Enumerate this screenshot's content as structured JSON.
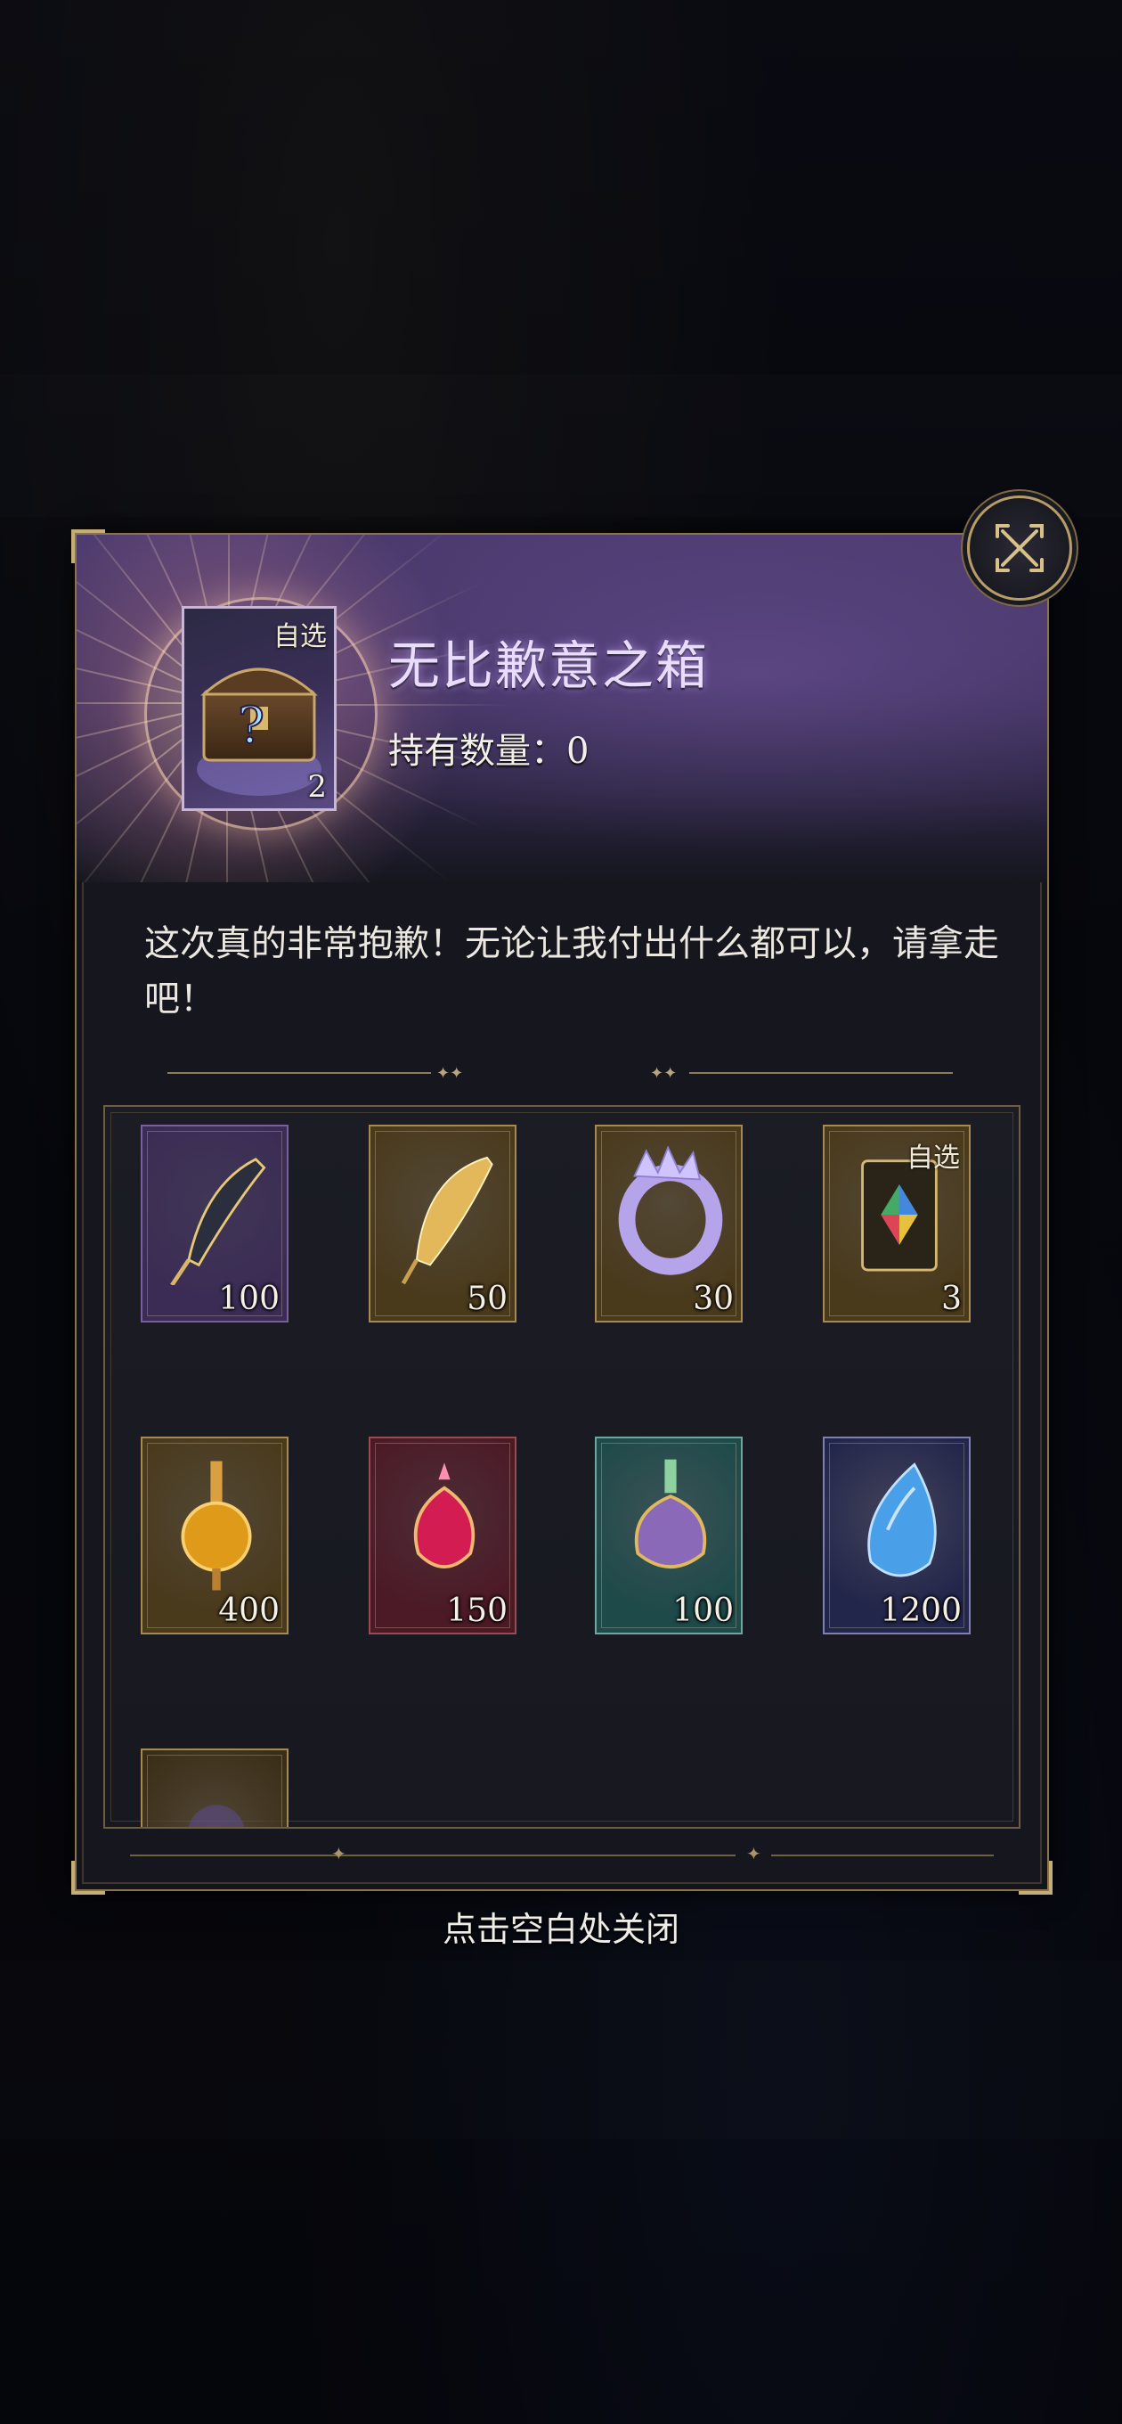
{
  "dialog": {
    "title": "无比歉意之箱",
    "owned_label": "持有数量：0",
    "main_item": {
      "tag": "自选",
      "count": "2",
      "icon": "mystery-chest-icon"
    },
    "description": "这次真的非常抱歉！无论让我付出什么都可以，请拿走吧！",
    "close_icon": "close-x-icon"
  },
  "rewards": [
    {
      "name": "dark-quill-icon",
      "count": "100",
      "frame": "#7a5fa0",
      "bg": "#3b2c55"
    },
    {
      "name": "golden-feather-icon",
      "count": "50",
      "frame": "#a68a52",
      "bg": "#4a3a1c"
    },
    {
      "name": "crystal-ring-icon",
      "count": "30",
      "frame": "#a68a52",
      "bg": "#4a3a1c"
    },
    {
      "name": "selectable-card-icon",
      "count": "3",
      "tag": "自选",
      "frame": "#a68a52",
      "bg": "#4a3a1c"
    },
    {
      "name": "amber-potion-icon",
      "count": "400",
      "frame": "#a68a52",
      "bg": "#4a3a1c"
    },
    {
      "name": "crimson-potion-icon",
      "count": "150",
      "frame": "#9a4a55",
      "bg": "#4c1a26"
    },
    {
      "name": "teal-potion-icon",
      "count": "100",
      "frame": "#6fa6a0",
      "bg": "#1f4a4a"
    },
    {
      "name": "blue-crystal-icon",
      "count": "1200",
      "frame": "#8080b0",
      "bg": "#22264a"
    },
    {
      "name": "partial-item-icon",
      "count": "",
      "frame": "#a68a52",
      "bg": "#3a2e18"
    }
  ],
  "footer": {
    "hint": "点击空白处关闭"
  }
}
